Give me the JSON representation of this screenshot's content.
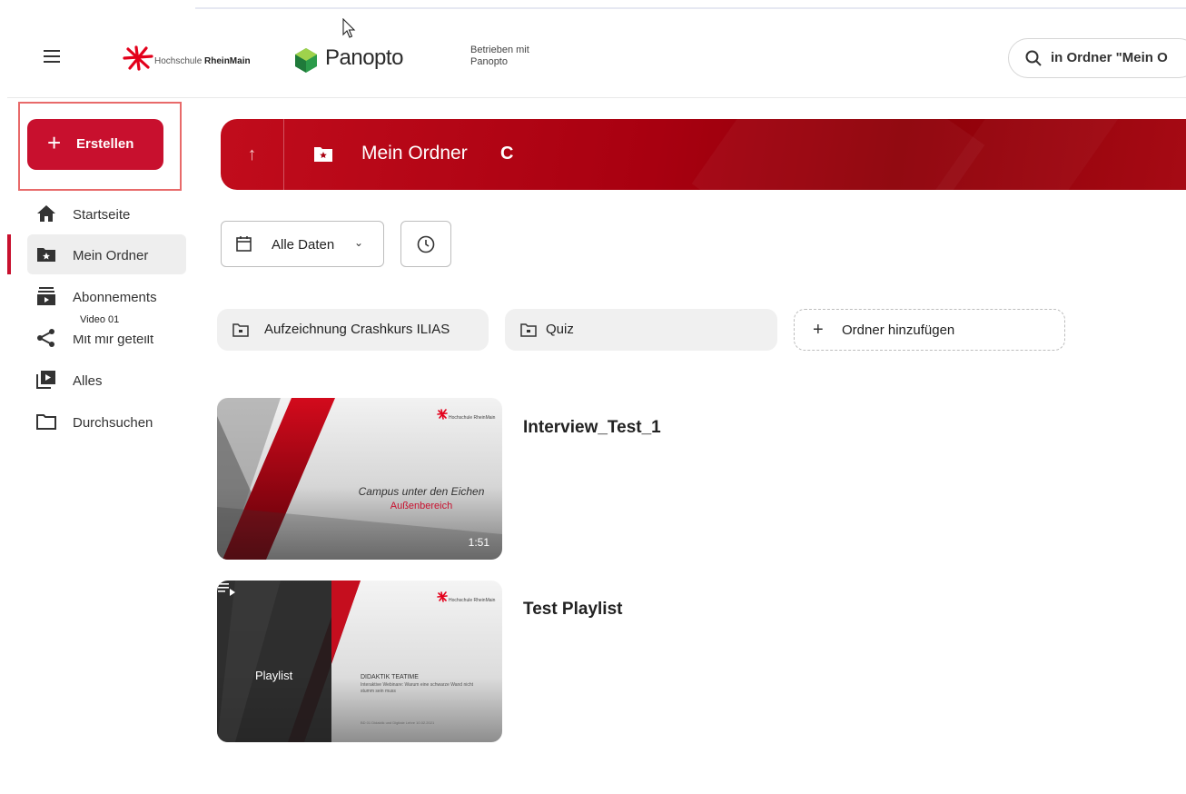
{
  "header": {
    "hsrm_logo_text_light": "Hochschule ",
    "hsrm_logo_text_bold": "RheinMain",
    "panopto_brand": "Panopto",
    "powered_by": "Betrieben mit Panopto",
    "search_placeholder": "in Ordner \"Mein O"
  },
  "sidebar": {
    "create_label": "Erstellen",
    "items": [
      {
        "label": "Startseite",
        "icon": "home-icon"
      },
      {
        "label": "Mein Ordner",
        "icon": "folder-star-icon"
      },
      {
        "label": "Abonnements",
        "icon": "subscriptions-icon"
      },
      {
        "label": "Mit mir geteilt",
        "icon": "share-icon"
      },
      {
        "label": "Alles",
        "icon": "play-library-icon"
      },
      {
        "label": "Durchsuchen",
        "icon": "folder-outline-icon"
      }
    ],
    "tooltip": "Video 01"
  },
  "banner": {
    "title": "Mein Ordner",
    "up_symbol": "↑",
    "refresh_symbol": "C"
  },
  "filters": {
    "date_label": "Alle Daten"
  },
  "folders": [
    {
      "label": "Aufzeichnung Crashkurs ILIAS"
    },
    {
      "label": "Quiz"
    }
  ],
  "add_folder_label": "Ordner hinzufügen",
  "sessions": [
    {
      "title": "Interview_Test_1",
      "thumb_line1": "Campus unter den Eichen",
      "thumb_line2": "Außenbereich",
      "duration": "1:51",
      "thumb_brand": "Hochschule RheinMain"
    },
    {
      "title": "Test Playlist",
      "badge": "Playlist",
      "thumb_brand": "Hochschule RheinMain",
      "slide_title": "DIDAKTIK TEATIME",
      "slide_sub": "Interaktive Webinare: Warum eine schwarze Wand nicht stumm sein muss",
      "slide_foot": "BD 01 Didaktik und Digitale Lehre 10.02.2021"
    }
  ],
  "colors": {
    "brand_red": "#c8102e",
    "banner_dark": "#8e0008"
  }
}
